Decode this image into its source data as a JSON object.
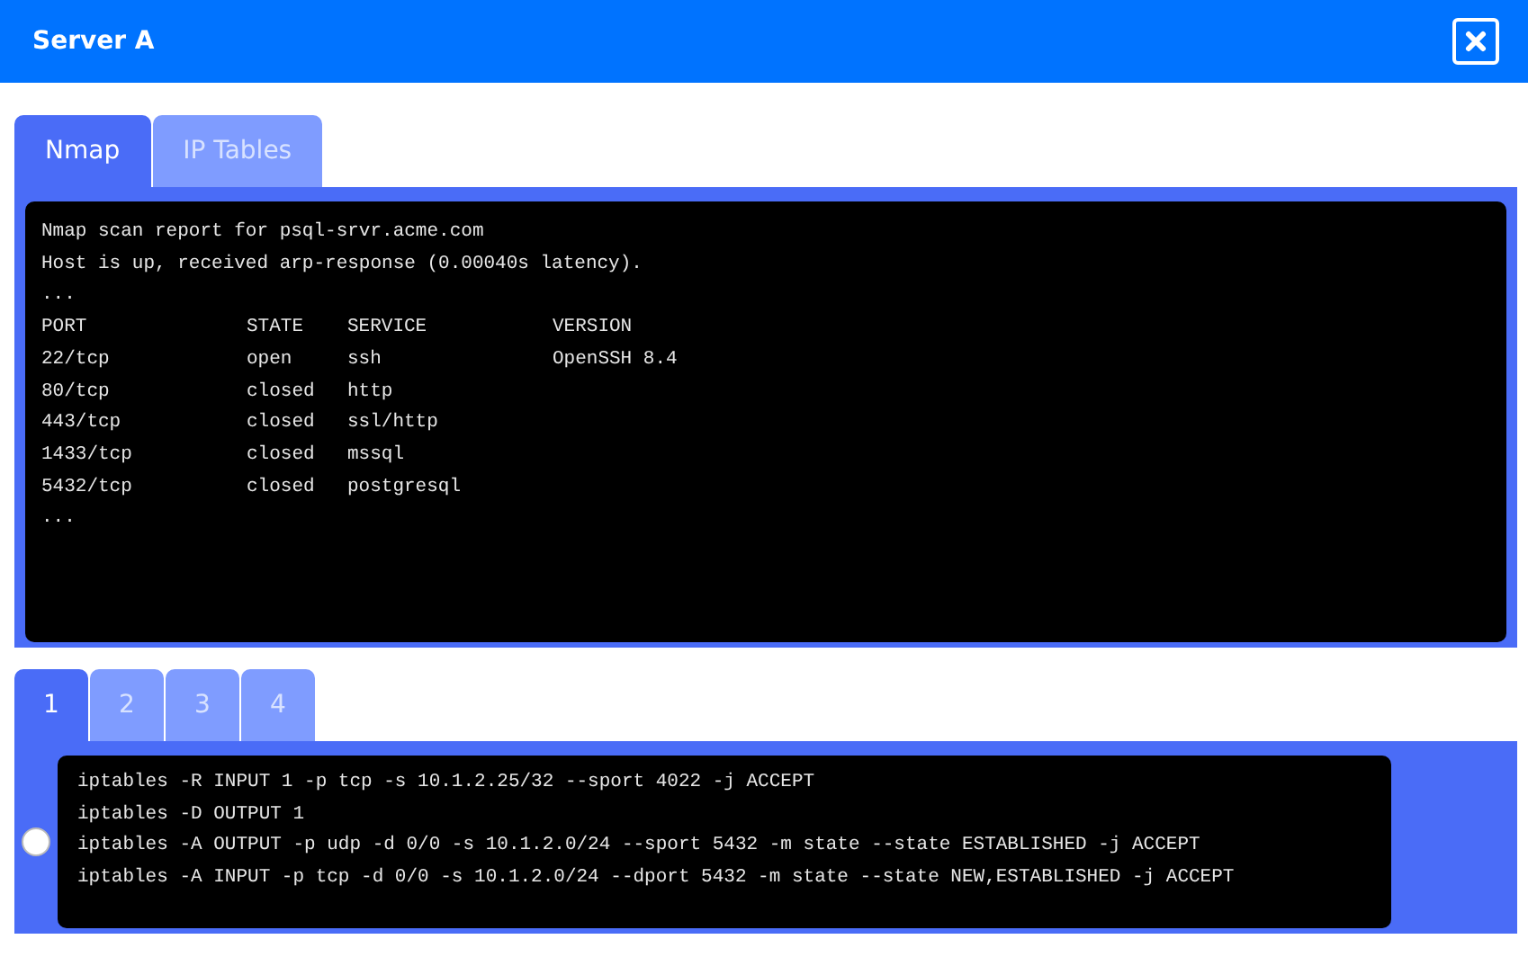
{
  "window": {
    "title": "Server A"
  },
  "tabs": [
    {
      "label": "Nmap",
      "selected": true
    },
    {
      "label": "IP Tables",
      "selected": false
    }
  ],
  "nmap_output": {
    "lines_before": [
      "Nmap scan report for psql-srvr.acme.com",
      "Host is up, received arp-response (0.00040s latency).",
      "..."
    ],
    "columns": [
      "PORT",
      "STATE",
      "SERVICE",
      "VERSION"
    ],
    "rows": [
      [
        "22/tcp",
        "open",
        "ssh",
        "OpenSSH 8.4"
      ],
      [
        "80/tcp",
        "closed",
        "http"
      ],
      [
        "443/tcp",
        "closed",
        "ssl/http"
      ],
      [
        "1433/tcp",
        "closed",
        "mssql"
      ],
      [
        "5432/tcp",
        "closed",
        "postgresql"
      ]
    ],
    "lines_after": [
      "..."
    ]
  },
  "rule_tabs": [
    {
      "label": "1",
      "selected": true
    },
    {
      "label": "2",
      "selected": false
    },
    {
      "label": "3",
      "selected": false
    },
    {
      "label": "4",
      "selected": false
    }
  ],
  "rule_option": {
    "selected": false,
    "lines": [
      "iptables -R INPUT 1 -p tcp -s 10.1.2.25/32 --sport 4022 -j ACCEPT",
      "iptables -D OUTPUT 1",
      "iptables -A OUTPUT -p udp -d 0/0 -s 10.1.2.0/24 --sport 5432 -m state --state ESTABLISHED -j ACCEPT",
      "iptables -A INPUT -p tcp -d 0/0 -s 10.1.2.0/24 --dport 5432 -m state --state NEW,ESTABLISHED -j ACCEPT"
    ]
  }
}
